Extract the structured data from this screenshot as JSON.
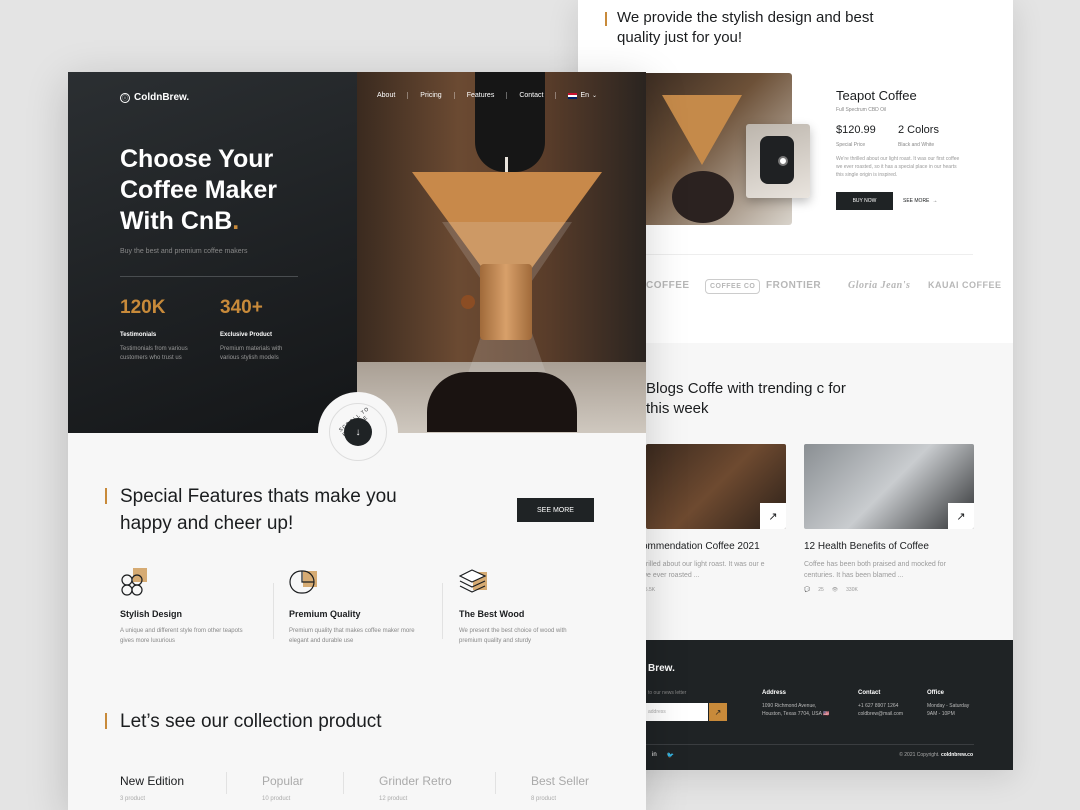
{
  "back": {
    "lead": "We provide the stylish design and best quality just for you!",
    "product": {
      "title": "Teapot Coffee",
      "subtitle": "Full Spectrum CBD Oil",
      "price": "$120.99",
      "price_label": "Special Price",
      "colors": "2 Colors",
      "colors_label": "Black and White",
      "description": "We're thrilled about our light roast. It was our first coffee we ever roasted, so it has a special place in our hearts this single origin is inspired.",
      "buy_label": "BUY NOW",
      "see_more_label": "SEE MORE"
    },
    "brands": [
      "COFFEE",
      "COFFEE CO",
      "FRONTIER",
      "Gloria Jean's",
      "KAUAI COFFEE"
    ],
    "blogs": {
      "title": "Blogs Coffe with trending c for this week",
      "items": [
        {
          "title": "ommendation Coffee 2021",
          "desc": "hrilled about our light roast. It was our e we ever roasted ...",
          "comments": "",
          "views": "25.5K"
        },
        {
          "title": "12 Health Benefits of Coffee",
          "desc": "Coffee has been both praised and mocked for centuries. It has been blamed ...",
          "comments": "25",
          "views": "330K"
        }
      ]
    },
    "footer": {
      "logo": "Brew.",
      "newsletter": "to our news letter",
      "input_placeholder": "address",
      "address_h": "Address",
      "address_t": "1090 Richmond Avenue,\nHouston, Texas 7704, USA 🇺🇸",
      "contact_h": "Contact",
      "contact_t": "+1 627 8907 1264\ncoldbrew@mail.com",
      "office_h": "Office",
      "office_t": "Monday - Saturday\n9AM - 10PM",
      "copyright": "© 2021 Copyright.",
      "copyright_site": "coldnbrew.co",
      "social": [
        "in",
        "🐦"
      ]
    }
  },
  "front": {
    "logo": "ColdnBrew.",
    "nav": [
      "About",
      "Pricing",
      "Features",
      "Contact"
    ],
    "lang": "En",
    "hero": {
      "line1": "Choose Your",
      "line2": "Coffee Maker",
      "line3": "With CnB",
      "dot": ".",
      "sub": "Buy the best and premium coffee makers"
    },
    "stats": [
      {
        "num": "120K",
        "label": "Testimonials",
        "desc": "Testimonials from various customers who trust us"
      },
      {
        "num": "340+",
        "label": "Exclusive Product",
        "desc": "Premium materials with various stylish models"
      }
    ],
    "scroll": "SCROLL TO EXPLORE",
    "features_title_1": "Special Features thats make you",
    "features_title_2": "happy and cheer up!",
    "see_more": "SEE MORE",
    "features": [
      {
        "title": "Stylish Design",
        "desc": "A unique and different style from other teapots gives more luxurious"
      },
      {
        "title": "Premium Quality",
        "desc": "Premium quality that makes coffee maker more elegant and durable use"
      },
      {
        "title": "The Best Wood",
        "desc": "We present the best choice of wood with premium quality and sturdy"
      }
    ],
    "collection_title": "Let’s see our collection product",
    "tabs": [
      {
        "name": "New Edition",
        "count": "3 product"
      },
      {
        "name": "Popular",
        "count": "10 product"
      },
      {
        "name": "Grinder Retro",
        "count": "12 product"
      },
      {
        "name": "Best Seller",
        "count": "8 product"
      }
    ]
  },
  "colors": {
    "accent": "#c88a3a",
    "dark": "#1f2325"
  }
}
